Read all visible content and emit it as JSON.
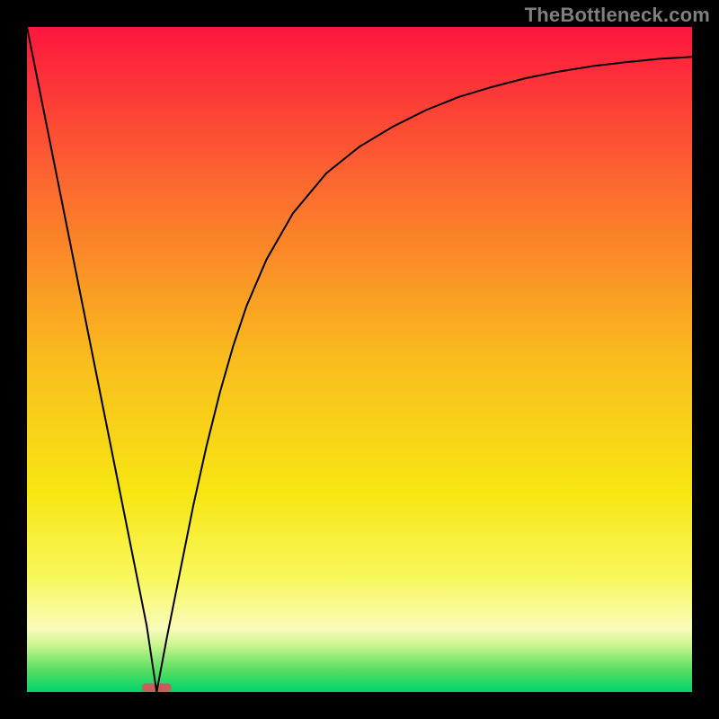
{
  "attribution": "TheBottleneck.com",
  "chart_data": {
    "type": "line",
    "title": "",
    "xlabel": "",
    "ylabel": "",
    "xlim": [
      0,
      100
    ],
    "ylim": [
      0,
      100
    ],
    "background_gradient": {
      "stops": [
        {
          "offset": 0.0,
          "color": "#fe163e"
        },
        {
          "offset": 0.25,
          "color": "#fc6d2e"
        },
        {
          "offset": 0.5,
          "color": "#f9bd1d"
        },
        {
          "offset": 0.7,
          "color": "#f7e612"
        },
        {
          "offset": 0.83,
          "color": "#f8f85e"
        },
        {
          "offset": 0.905,
          "color": "#fafbba"
        },
        {
          "offset": 0.93,
          "color": "#c9f590"
        },
        {
          "offset": 0.965,
          "color": "#5ddf62"
        },
        {
          "offset": 1.0,
          "color": "#00d36a"
        }
      ]
    },
    "series": [
      {
        "name": "bottleneck-curve",
        "x": [
          0,
          2,
          4,
          6,
          8,
          10,
          12,
          14,
          16,
          18,
          19.5,
          21,
          23,
          25,
          27,
          29,
          31,
          33,
          36,
          40,
          45,
          50,
          55,
          60,
          65,
          70,
          75,
          80,
          85,
          90,
          95,
          100
        ],
        "y": [
          100,
          90,
          80,
          70,
          60,
          50,
          40,
          30,
          20,
          10,
          0,
          8,
          18,
          28,
          37,
          45,
          52,
          58,
          65,
          72,
          78,
          82,
          85,
          87.5,
          89.5,
          91,
          92.3,
          93.3,
          94.1,
          94.7,
          95.2,
          95.5
        ]
      }
    ],
    "marker": {
      "x_center": 19.5,
      "width": 4.4,
      "height": 1.3
    },
    "grid": false,
    "legend": false
  }
}
